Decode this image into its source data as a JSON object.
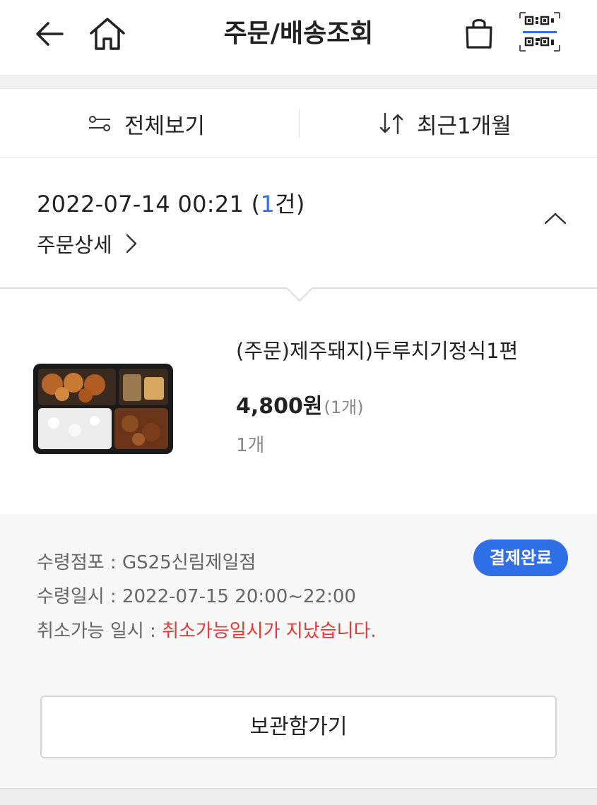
{
  "header": {
    "title": "주문/배송조회",
    "icons": [
      "back-arrow-icon",
      "home-icon",
      "shopping-bag-icon",
      "qr-code-icon"
    ]
  },
  "filters": {
    "all_label": "전체보기",
    "period_label": "최근1개월"
  },
  "order": {
    "datetime": "2022-07-14  00:21",
    "count_prefix": "(",
    "count": "1",
    "count_suffix": "건)",
    "detail_label": "주문상세"
  },
  "product": {
    "name": "(주문)제주돼지)두루치기정식1편",
    "price": "4,800원",
    "price_qty": "(1개)",
    "qty": "1개"
  },
  "pickup": {
    "store_label": "수령점포 : GS25신림제일점",
    "time_label": "수령일시 : 2022-07-15 20:00~22:00",
    "cancel_label": "취소가능 일시 : ",
    "cancel_value": "취소가능일시가 지났습니다.",
    "status": "결제완료",
    "storage_button": "보관함가기"
  },
  "colors": {
    "accent": "#2f6fe8",
    "warning": "#e53935"
  }
}
